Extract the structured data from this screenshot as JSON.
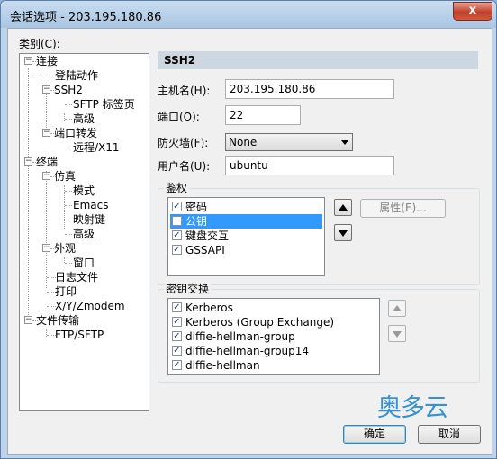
{
  "window": {
    "title": "会话选项 - 203.195.180.86",
    "close_glyph": "x"
  },
  "category": {
    "label": "类别(C):",
    "tree": [
      {
        "label": "连接",
        "expander": "−"
      },
      {
        "label": "登陆动作"
      },
      {
        "label": "SSH2",
        "expander": "−"
      },
      {
        "label": "SFTP 标签页"
      },
      {
        "label": "高级"
      },
      {
        "label": "端口转发",
        "expander": "−"
      },
      {
        "label": "远程/X11"
      },
      {
        "label": "终端",
        "expander": "−"
      },
      {
        "label": "仿真",
        "expander": "−"
      },
      {
        "label": "模式"
      },
      {
        "label": "Emacs"
      },
      {
        "label": "映射键"
      },
      {
        "label": "高级"
      },
      {
        "label": "外观",
        "expander": "−"
      },
      {
        "label": "窗口"
      },
      {
        "label": "日志文件"
      },
      {
        "label": "打印"
      },
      {
        "label": "X/Y/Zmodem"
      },
      {
        "label": "文件传输",
        "expander": "−"
      },
      {
        "label": "FTP/SFTP"
      }
    ]
  },
  "ssh2": {
    "header": "SSH2",
    "hostname_label": "主机名(H):",
    "hostname_value": "203.195.180.86",
    "port_label": "端口(O):",
    "port_value": "22",
    "firewall_label": "防火墙(F):",
    "firewall_value": "None",
    "username_label": "用户名(U):",
    "username_value": "ubuntu"
  },
  "auth": {
    "title": "鉴权",
    "items": [
      {
        "label": "密码",
        "checked": true,
        "selected": false
      },
      {
        "label": "公钥",
        "checked": false,
        "selected": true
      },
      {
        "label": "键盘交互",
        "checked": true,
        "selected": false
      },
      {
        "label": "GSSAPI",
        "checked": true,
        "selected": false
      }
    ],
    "properties_label": "属性(E)..."
  },
  "kex": {
    "title": "密钥交换",
    "items": [
      {
        "label": "Kerberos",
        "checked": true
      },
      {
        "label": "Kerberos (Group Exchange)",
        "checked": true
      },
      {
        "label": "diffie-hellman-group",
        "checked": true
      },
      {
        "label": "diffie-hellman-group14",
        "checked": true
      },
      {
        "label": "diffie-hellman",
        "checked": true
      }
    ]
  },
  "buttons": {
    "ok": "确定",
    "cancel": "取消"
  },
  "watermark": "奥多云",
  "icons": {
    "up": "triangle-up-icon",
    "down": "triangle-down-icon",
    "checkbox": "check-mark-icon",
    "expander": "minus-box-icon"
  },
  "colors": {
    "selection": "#3399ff",
    "header_band": "#ccd7e1",
    "close_button": "#c0402a",
    "watermark": "#3592d2"
  }
}
